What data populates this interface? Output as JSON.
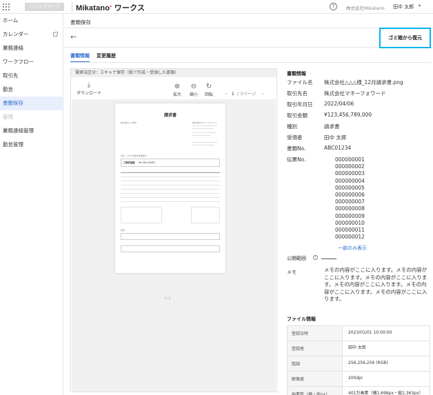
{
  "topbar": {
    "tenant_chip": "○○○○グループ",
    "logo_text": "Mikatano",
    "logo_suffix": "ワークス",
    "tenant_name": "株式会社Mikatano",
    "user_name": "田中 太郎",
    "user_caret": "▾"
  },
  "sidebar": {
    "items": [
      {
        "label": "ホーム"
      },
      {
        "label": "カレンダー"
      },
      {
        "label": "業務連絡"
      },
      {
        "label": "ワークフロー"
      },
      {
        "label": "取引先"
      },
      {
        "label": "勤怠"
      },
      {
        "label": "書類保存"
      },
      {
        "label": "管理"
      },
      {
        "label": "業務連絡管理"
      },
      {
        "label": "勤怠管理"
      }
    ],
    "active_index": 6
  },
  "main": {
    "page_title": "書類保存",
    "back_arrow": "←",
    "restore_button": "ゴミ箱から復元",
    "tabs": [
      {
        "label": "書類情報",
        "active": true
      },
      {
        "label": "変更履歴",
        "active": false
      }
    ]
  },
  "viewer": {
    "header": "電帳法区分：スキャナ保存（紙で作成・受領した書類）",
    "download_label": "ダウンロード",
    "zoom_in_label": "拡大",
    "zoom_out_label": "縮小",
    "rotate_label": "回転",
    "page_current": "1",
    "page_total_label": "/ 3ページ",
    "prev_icon": "‹",
    "next_icon": "›",
    "paper": {
      "title": "請求書",
      "to": "株式会社○○御中",
      "from": "株式会社マネーフォワード",
      "subject": "件名：2022年度請求書御中",
      "amount_label": "ご請求金額",
      "amount": "¥6,565,600円",
      "notes_label": "備考",
      "page_number": "1 / 1"
    }
  },
  "doc_info": {
    "heading": "書類情報",
    "rows": [
      {
        "key": "ファイル名",
        "value": "株式会社△△△様_12月請求書.png"
      },
      {
        "key": "取引先名",
        "value": "株式会社マネーフォワード"
      },
      {
        "key": "取引年月日",
        "value": "2022/04/06"
      },
      {
        "key": "取引金額",
        "value": "¥123,456,789,000"
      },
      {
        "key": "種別",
        "value": "請求書"
      },
      {
        "key": "受領者",
        "value": "田中 太郎"
      },
      {
        "key": "書類No.",
        "value": "ABC01234"
      },
      {
        "key": "伝票No.",
        "value": ""
      }
    ],
    "invoice_numbers": [
      "000000001",
      "000000002",
      "000000003",
      "000000004",
      "000000005",
      "000000006",
      "000000007",
      "000000008",
      "000000009",
      "000000010",
      "000000011",
      "000000012"
    ],
    "show_partial": "一部のみ表示",
    "public_label": "公開範囲",
    "memo_label": "メモ",
    "memo_value": "メモの内容がここに入ります。メモの内容がここに入ります。メモの内容がここに入ります。メモの内容がここに入ります。メモの内容がここに入ります。メモの内容がここに入ります。"
  },
  "file_info": {
    "heading": "ファイル情報",
    "rows": [
      {
        "key": "登録日時",
        "value": "2023/01/01 10:00:00"
      },
      {
        "key": "登録者",
        "value": "田中 太郎"
      },
      {
        "key": "階調",
        "value": "256,256,256 (RGB)"
      },
      {
        "key": "解像度",
        "value": "200dpi"
      },
      {
        "key": "画素数（横・縦px）",
        "value": "401万画素（横1,698px・縦2,363px）"
      }
    ]
  },
  "colors": {
    "accent": "#2f6fd1",
    "highlight_border": "#00b4ef",
    "active_nav_bg": "#e8eefb"
  }
}
